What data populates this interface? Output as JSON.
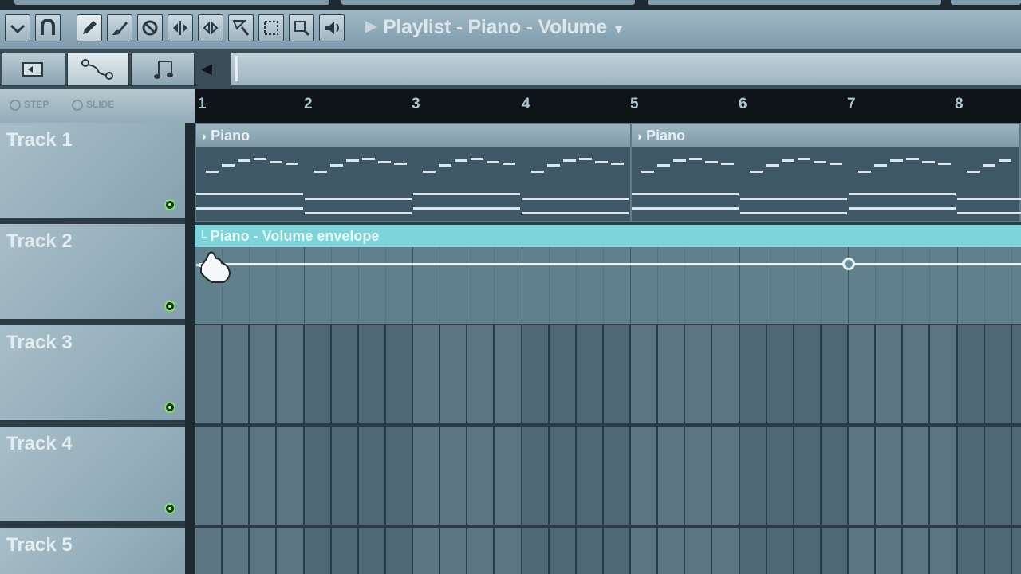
{
  "window": {
    "title": "Playlist - Piano - Volume"
  },
  "toolbar": {
    "icons": [
      "menu-arrow-icon",
      "magnet-icon",
      "pencil-icon",
      "paint-brush-icon",
      "mute-icon",
      "slip-icon",
      "slice-icon",
      "select-icon",
      "zoom-icon",
      "speaker-icon"
    ]
  },
  "tabs": [
    {
      "icon": "back-step-icon"
    },
    {
      "icon": "automation-curve-icon"
    },
    {
      "icon": "note-icon"
    }
  ],
  "stepbar": {
    "step_label": "STEP",
    "slide_label": "SLIDE"
  },
  "ruler": {
    "bars": [
      "1",
      "2",
      "3",
      "4",
      "5",
      "6",
      "7",
      "8"
    ]
  },
  "tracks": [
    {
      "name": "Track 1"
    },
    {
      "name": "Track 2"
    },
    {
      "name": "Track 3"
    },
    {
      "name": "Track 4"
    },
    {
      "name": "Track 5"
    }
  ],
  "clips": {
    "piano_1": "Piano",
    "piano_2": "Piano",
    "envelope": "Piano - Volume envelope"
  },
  "colors": {
    "accent": "#7dd3d7",
    "led": "#7be266",
    "background": "#2d3d47"
  }
}
